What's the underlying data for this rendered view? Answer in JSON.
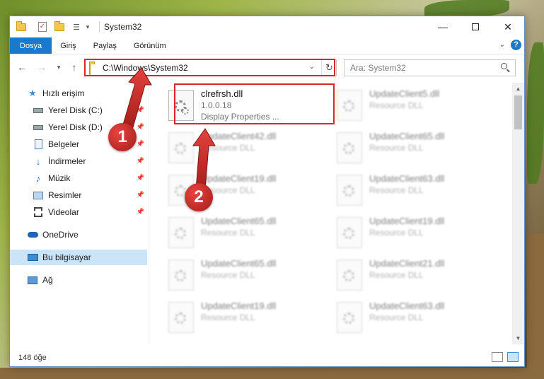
{
  "window": {
    "title": "System32",
    "minimize": "—",
    "close": "✕"
  },
  "ribbon": {
    "tabs": [
      {
        "label": "Dosya"
      },
      {
        "label": "Giriş"
      },
      {
        "label": "Paylaş"
      },
      {
        "label": "Görünüm"
      }
    ],
    "help": "?"
  },
  "address": {
    "path": "C:\\Windows\\System32",
    "search_placeholder": "Ara: System32"
  },
  "nav": {
    "items": [
      {
        "label": "Hızlı erişim",
        "icon": "star-icon"
      },
      {
        "label": "Yerel Disk (C:)",
        "icon": "drive-icon"
      },
      {
        "label": "Yerel Disk (D:)",
        "icon": "drive-icon"
      },
      {
        "label": "Belgeler",
        "icon": "documents-icon"
      },
      {
        "label": "İndirmeler",
        "icon": "downloads-icon"
      },
      {
        "label": "Müzik",
        "icon": "music-icon"
      },
      {
        "label": "Resimler",
        "icon": "pictures-icon"
      },
      {
        "label": "Videolar",
        "icon": "videos-icon"
      },
      {
        "label": "OneDrive",
        "icon": "cloud-icon"
      },
      {
        "label": "Bu bilgisayar",
        "icon": "computer-icon"
      },
      {
        "label": "Ağ",
        "icon": "network-icon"
      }
    ]
  },
  "files": {
    "main": {
      "name": "clrefrsh.dll",
      "version": "1.0.0.18",
      "desc": "Display Properties ..."
    },
    "left": [
      {
        "name": "UpdateClient42.dll",
        "desc": "Resource DLL"
      },
      {
        "name": "UpdateClient19.dll",
        "desc": "Resource DLL"
      },
      {
        "name": "UpdateClient65.dll",
        "desc": "Resource DLL"
      },
      {
        "name": "UpdateClient65.dll",
        "desc": "Resource DLL"
      },
      {
        "name": "UpdateClient19.dll",
        "desc": "Resource DLL"
      }
    ],
    "right": [
      {
        "name": "UpdateClient5.dll",
        "desc": "Resource DLL"
      },
      {
        "name": "UpdateClient65.dll",
        "desc": "Resource DLL"
      },
      {
        "name": "UpdateClient63.dll",
        "desc": "Resource DLL"
      },
      {
        "name": "UpdateClient19.dll",
        "desc": "Resource DLL"
      },
      {
        "name": "UpdateClient21.dll",
        "desc": "Resource DLL"
      },
      {
        "name": "UpdateClient63.dll",
        "desc": "Resource DLL"
      }
    ]
  },
  "status": {
    "count": "148 öğe"
  },
  "callouts": {
    "one": "1",
    "two": "2"
  },
  "colors": {
    "accent": "#1979ca",
    "highlight": "#d7272c",
    "selected": "#cce4f7"
  }
}
